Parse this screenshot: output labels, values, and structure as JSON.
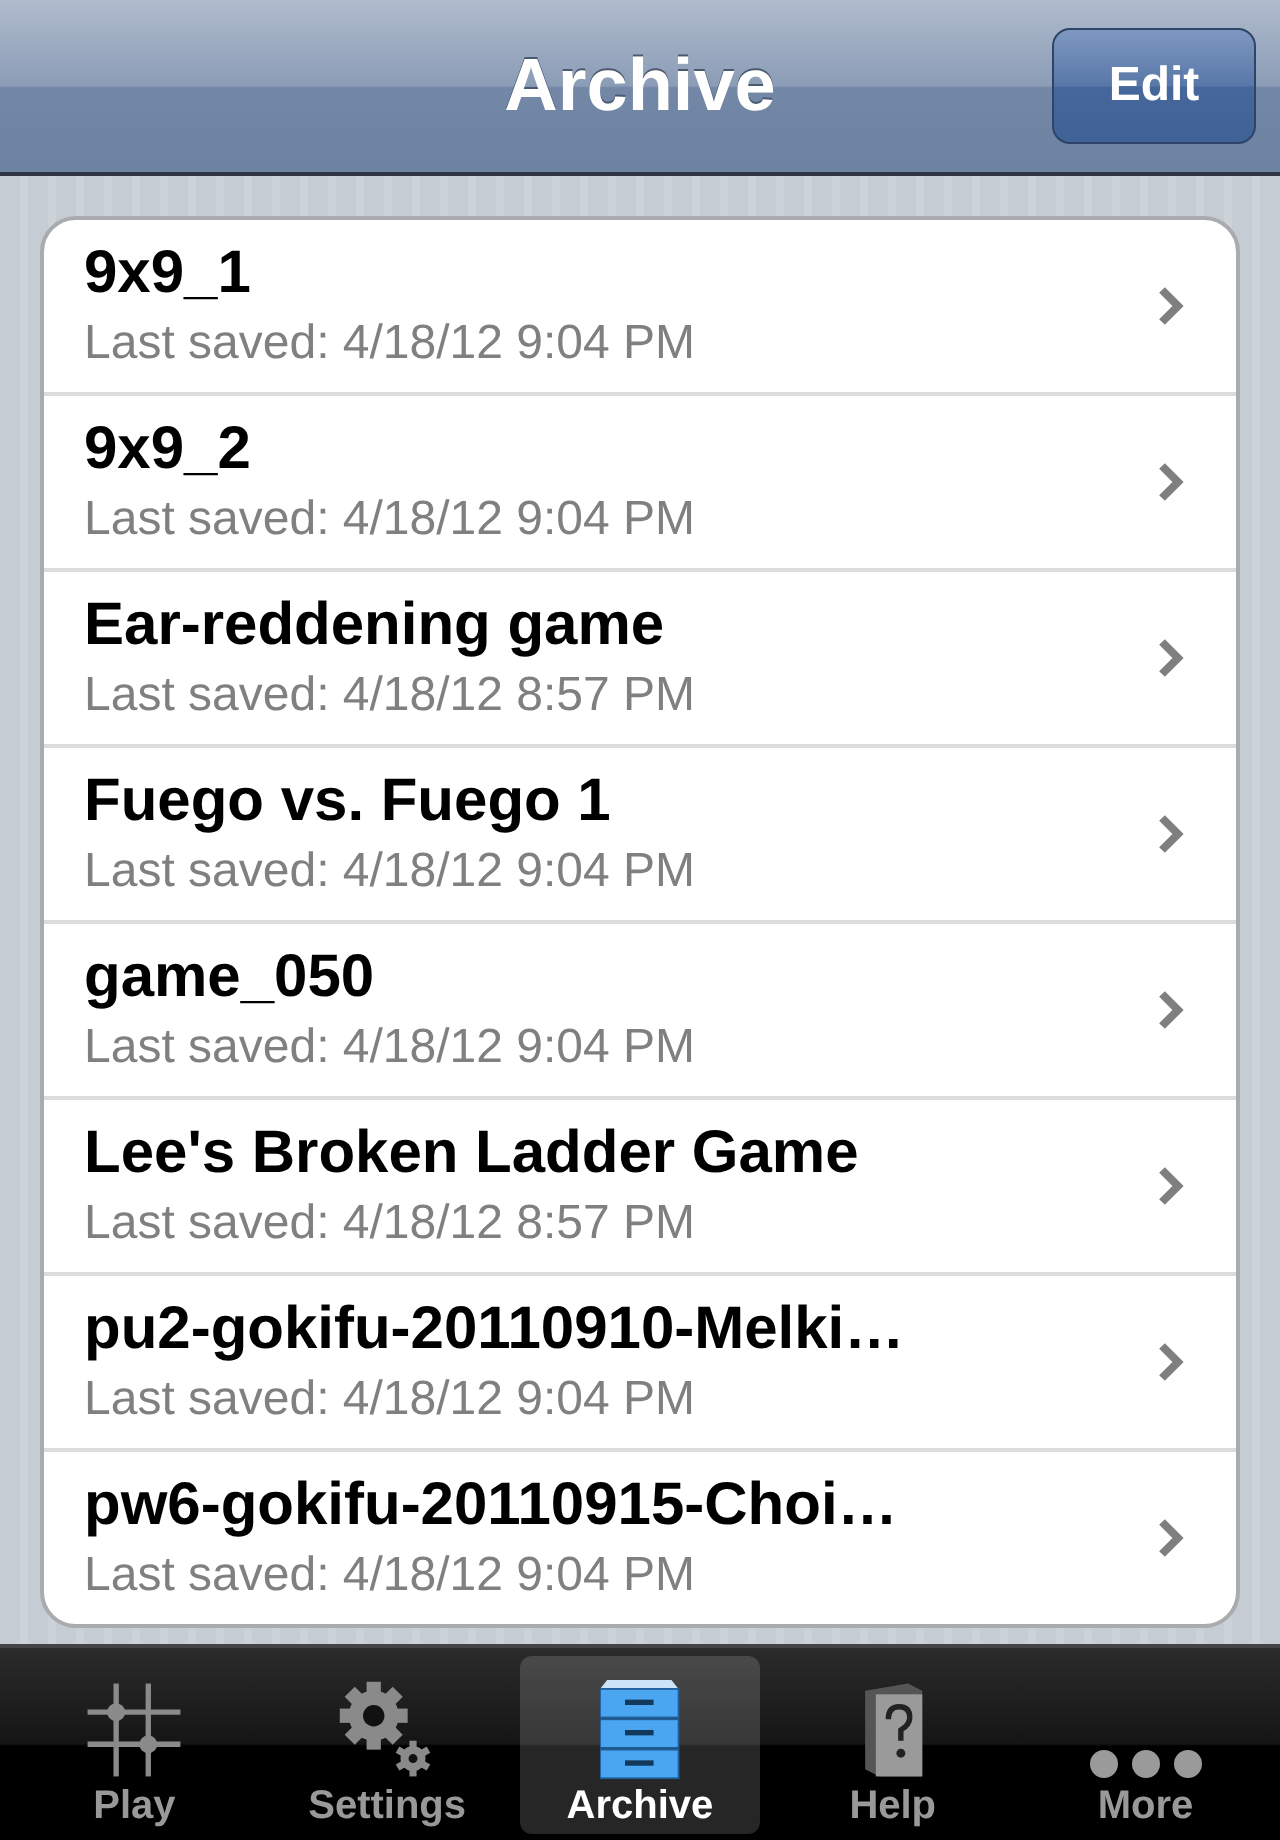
{
  "nav_bar": {
    "title": "Archive",
    "edit_button": "Edit"
  },
  "games": [
    {
      "name": "9x9_1",
      "subtitle": "Last saved: 4/18/12 9:04 PM"
    },
    {
      "name": "9x9_2",
      "subtitle": "Last saved: 4/18/12 9:04 PM"
    },
    {
      "name": "Ear-reddening game",
      "subtitle": "Last saved: 4/18/12 8:57 PM"
    },
    {
      "name": "Fuego vs. Fuego 1",
      "subtitle": "Last saved: 4/18/12 9:04 PM"
    },
    {
      "name": "game_050",
      "subtitle": "Last saved: 4/18/12 9:04 PM"
    },
    {
      "name": "Lee's Broken Ladder Game",
      "subtitle": "Last saved: 4/18/12 8:57 PM"
    },
    {
      "name": "pu2-gokifu-20110910-Melki…",
      "subtitle": "Last saved: 4/18/12 9:04 PM"
    },
    {
      "name": "pw6-gokifu-20110915-Choi…",
      "subtitle": "Last saved: 4/18/12 9:04 PM"
    }
  ],
  "tab_bar": [
    {
      "label": "Play",
      "kind": "play",
      "selected": false
    },
    {
      "label": "Settings",
      "kind": "settings",
      "selected": false
    },
    {
      "label": "Archive",
      "kind": "archive",
      "selected": true
    },
    {
      "label": "Help",
      "kind": "help",
      "selected": false
    },
    {
      "label": "More",
      "kind": "more",
      "selected": false
    }
  ]
}
